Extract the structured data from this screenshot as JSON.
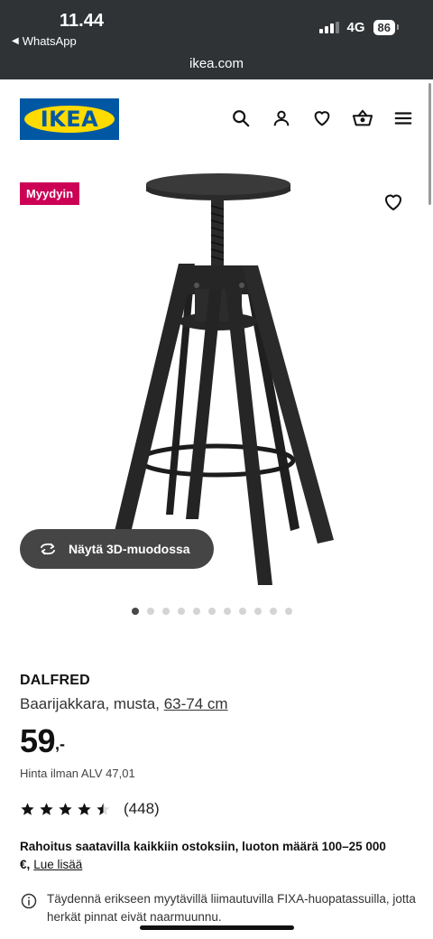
{
  "status": {
    "time": "11.44",
    "back_app": "WhatsApp",
    "network": "4G",
    "battery": "86"
  },
  "browser": {
    "url": "ikea.com"
  },
  "header": {
    "logo_text": "IKEA"
  },
  "product": {
    "badge": "Myydyin",
    "view3d_label": "Näytä 3D-muodossa",
    "image_count": 11,
    "active_image": 1,
    "name": "DALFRED",
    "desc_prefix": "Baarijakkara, musta, ",
    "size_link": "63-74 cm",
    "price_int": "59",
    "price_dec": ",-",
    "vat_text": "Hinta ilman ALV 47,01",
    "rating_value": 4.5,
    "rating_count": "(448)",
    "finance_text": "Rahoitus saatavilla kaikkiin ostoksiin, luoton määrä 100–25 000 €,",
    "finance_link": "Lue lisää",
    "info_note": "Täydennä erikseen myytävillä liimautuvilla FIXA-huopatassuilla, jotta herkät pinnat eivät naarmuunnu."
  }
}
